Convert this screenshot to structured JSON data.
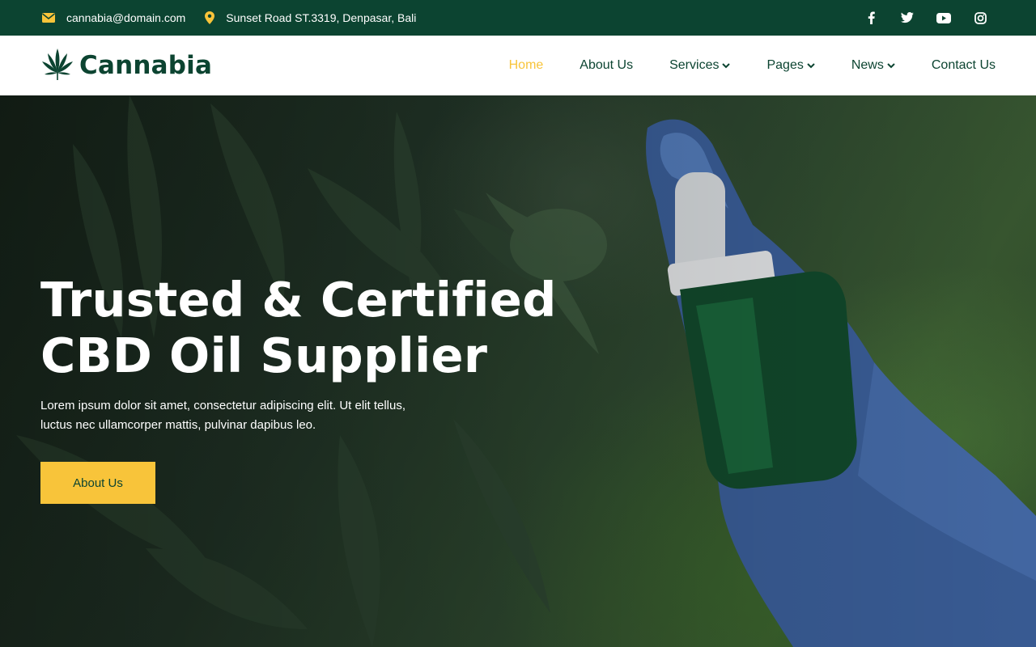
{
  "topbar": {
    "email": "cannabia@domain.com",
    "address": "Sunset Road ST.3319, Denpasar, Bali",
    "social": [
      "facebook-icon",
      "twitter-icon",
      "youtube-icon",
      "instagram-icon"
    ]
  },
  "brand": {
    "name": "Cannabia"
  },
  "nav": {
    "items": [
      {
        "label": "Home",
        "active": true
      },
      {
        "label": "About Us"
      },
      {
        "label": "Services",
        "dropdown": true
      },
      {
        "label": "Pages",
        "dropdown": true
      },
      {
        "label": "News",
        "dropdown": true
      },
      {
        "label": "Contact Us"
      }
    ]
  },
  "hero": {
    "title_line1": "Trusted & Certified",
    "title_line2": "CBD Oil Supplier",
    "desc_line1": "Lorem ipsum dolor sit amet, consectetur adipiscing elit. Ut elit tellus,",
    "desc_line2": "luctus nec ullamcorper mattis, pulvinar dapibus leo.",
    "button_label": "About Us"
  },
  "colors": {
    "primary": "#0c4431",
    "accent": "#f8c43a",
    "white": "#ffffff"
  }
}
